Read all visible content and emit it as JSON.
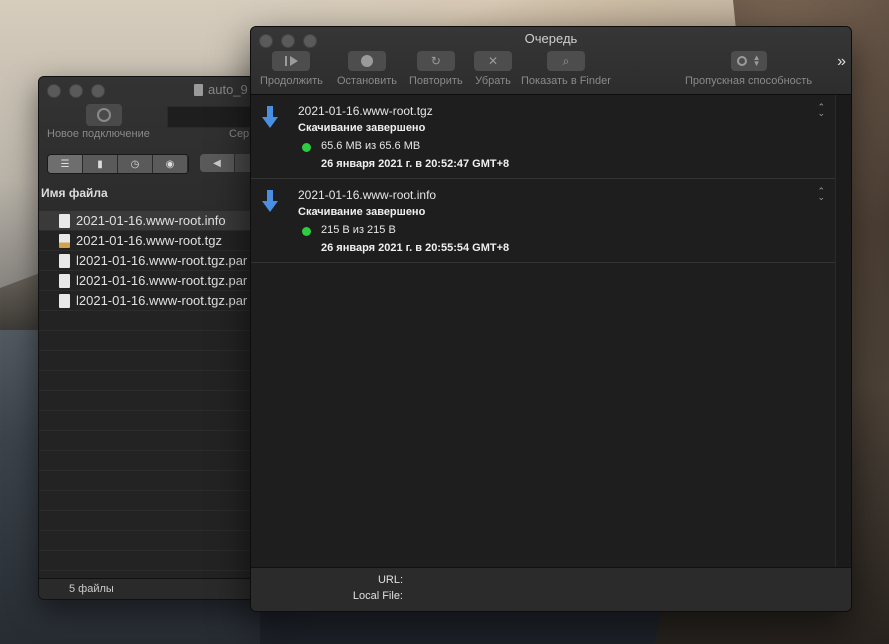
{
  "back_window": {
    "title": "auto_9",
    "new_connection_label": "Новое подключение",
    "server_label": "Сер",
    "column_header": "Имя файла",
    "files": [
      {
        "name": "2021-01-16.www-root.info",
        "icon": "document-icon",
        "selected": true
      },
      {
        "name": "2021-01-16.www-root.tgz",
        "icon": "archive-icon",
        "selected": false
      },
      {
        "name": "l2021-01-16.www-root.tgz.par",
        "icon": "document-icon",
        "selected": false
      },
      {
        "name": "l2021-01-16.www-root.tgz.par",
        "icon": "document-icon",
        "selected": false
      },
      {
        "name": "l2021-01-16.www-root.tgz.par",
        "icon": "document-icon",
        "selected": false
      }
    ],
    "status": "5 файлы"
  },
  "queue_window": {
    "title": "Очередь",
    "toolbar": {
      "resume": "Продолжить",
      "stop": "Остановить",
      "retry": "Повторить",
      "remove": "Убрать",
      "show_in_finder": "Показать в Finder",
      "bandwidth": "Пропускная способность",
      "overflow": "»"
    },
    "items": [
      {
        "filename": "2021-01-16.www-root.tgz",
        "status": "Скачивание завершено",
        "size": "65.6 MB из 65.6 MB",
        "date": "26 января 2021 г. в 20:52:47 GMT+8",
        "status_color": "#2ecc40"
      },
      {
        "filename": "2021-01-16.www-root.info",
        "status": "Скачивание завершено",
        "size": "215 B из 215 B",
        "date": "26 января 2021 г. в 20:55:54 GMT+8",
        "status_color": "#2ecc40"
      }
    ],
    "footer": {
      "url_label": "URL:",
      "local_file_label": "Local File:"
    }
  }
}
